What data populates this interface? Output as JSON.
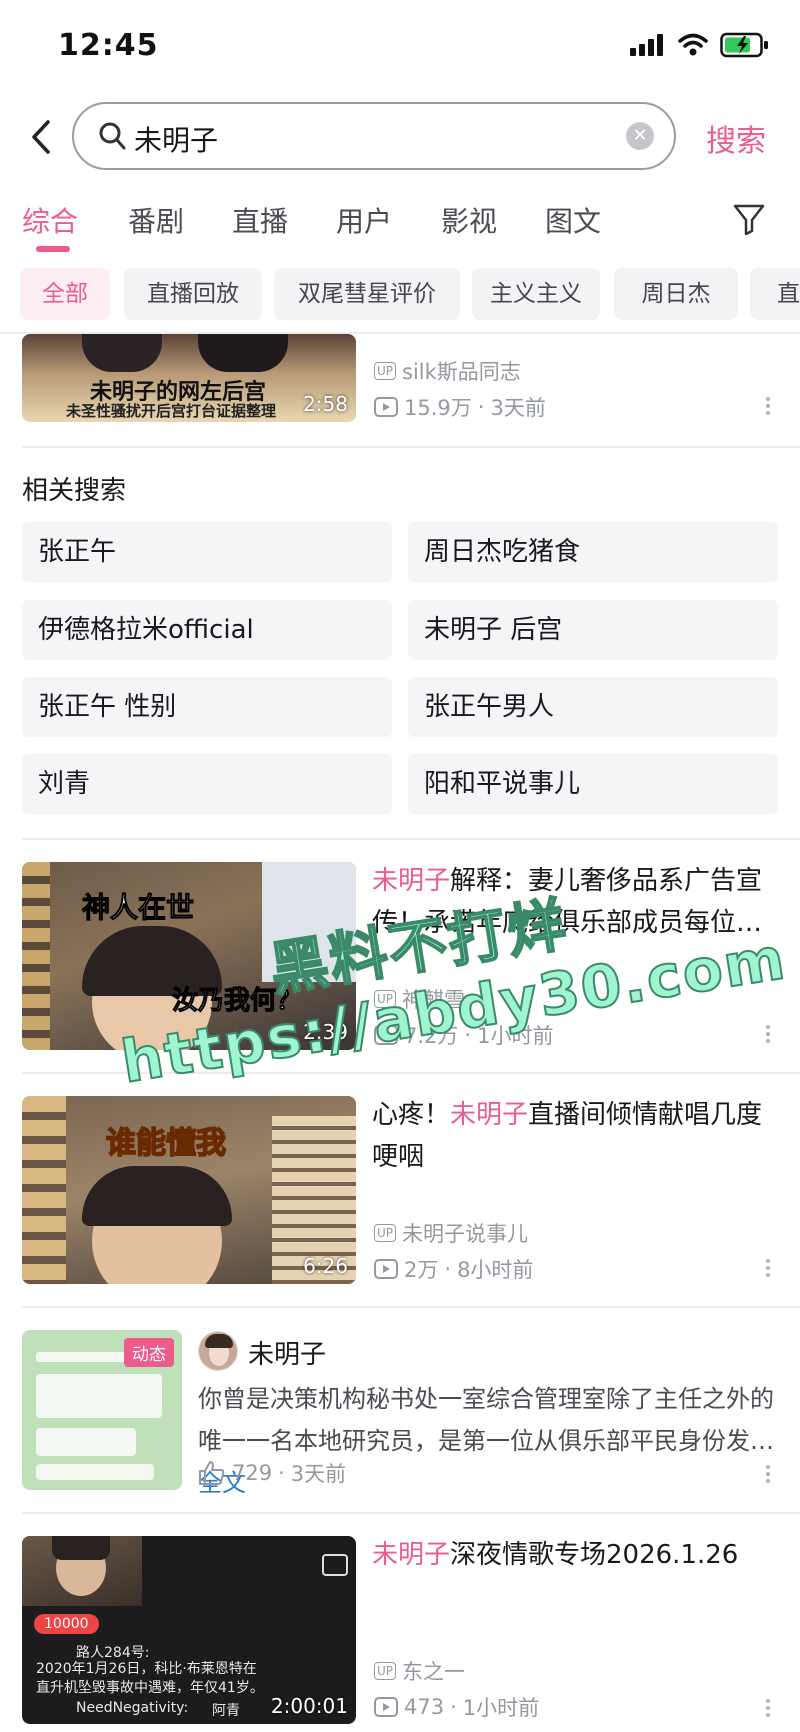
{
  "status": {
    "time": "12:45"
  },
  "search": {
    "query": "未明子",
    "submit_label": "搜索"
  },
  "tabs": [
    "综合",
    "番剧",
    "直播",
    "用户",
    "影视",
    "图文"
  ],
  "chips": [
    "全部",
    "直播回放",
    "双尾彗星评价",
    "主义主义",
    "周日杰",
    "直主"
  ],
  "top_video": {
    "thumb_title": "未明子的网左后宫",
    "thumb_subtitle": "未圣性骚扰开后宫打台证据整理",
    "duration": "2:58",
    "uploader": "silk斯品同志",
    "views": "15.9万",
    "time": "3天前"
  },
  "related": {
    "title": "相关搜索",
    "items": [
      "张正午",
      "周日杰吃猪食",
      "伊德格拉米official",
      "未明子 后宫",
      "张正午 性别",
      "张正午男人",
      "刘青",
      "阳和平说事儿"
    ]
  },
  "video1": {
    "title_hl": "未明子",
    "title_rest": "解释：妻儿奢侈品系广告宣传！承诺年底给俱乐部成员每位…",
    "caption_a": "神人在世",
    "caption_b": "汝乃我何？",
    "duration": "2:39",
    "uploader": "神麒雪",
    "views": "7.2万",
    "time": "1小时前"
  },
  "video2": {
    "title_pre": "心疼！",
    "title_hl": "未明子",
    "title_rest": "直播间倾情献唱几度哽咽",
    "caption": "谁能懂我",
    "duration": "6:26",
    "uploader": "未明子说事儿",
    "views": "2万",
    "time": "8小时前"
  },
  "post": {
    "badge": "动态",
    "author": "未明子",
    "text": "你曾是决策机构秘书处一室综合管理室除了主任之外的唯一一名本地研究员，是第一位从俱乐部平民身份发…",
    "full_label": "全文",
    "likes": "729",
    "time": "3天前"
  },
  "video3": {
    "title_hl": "未明子",
    "title_rest": "深夜情歌专场2026.1.26",
    "chat_count": "10000",
    "chat_line1_name": "路人284号:",
    "chat_line1_text": "2020年1月26日，科比·布莱恩特在直升机坠毁事故中遇难，年仅41岁。",
    "chat_line2_name": "NeedNegativity:",
    "chat_line2_text": "阿青",
    "duration": "2:00:01",
    "uploader": "东之一",
    "views": "473",
    "time": "1小时前"
  },
  "watermark": {
    "line1": "黑料不打烊",
    "line2": "https://abdy30.com"
  },
  "colors": {
    "accent": "#ee5c8d",
    "muted": "#9499a0",
    "chip_bg": "#f2f3f5",
    "link": "#2b7fc7",
    "watermark": "#9ff5cf"
  }
}
